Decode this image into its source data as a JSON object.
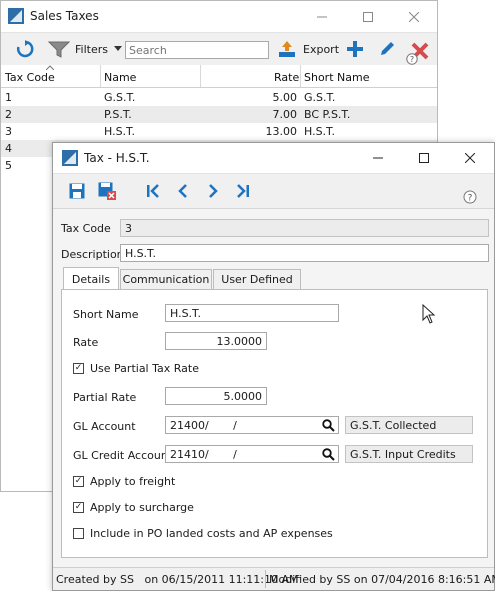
{
  "back_window": {
    "title": "Sales Taxes",
    "toolbar": {
      "filters_label": "Filters",
      "search_placeholder": "Search",
      "export_label": "Export"
    },
    "columns": [
      "Tax Code",
      "Name",
      "Rate",
      "Short Name"
    ],
    "rows": [
      {
        "code": "1",
        "name": "G.S.T.",
        "rate": "5.00",
        "short": "G.S.T."
      },
      {
        "code": "2",
        "name": "P.S.T.",
        "rate": "7.00",
        "short": "BC P.S.T."
      },
      {
        "code": "3",
        "name": "H.S.T.",
        "rate": "13.00",
        "short": "H.S.T."
      },
      {
        "code": "4",
        "name": "",
        "rate": "",
        "short": ""
      },
      {
        "code": "5",
        "name": "",
        "rate": "",
        "short": ""
      }
    ]
  },
  "front_window": {
    "title": "Tax - H.S.T.",
    "tax_code_label": "Tax Code",
    "tax_code_value": "3",
    "description_label": "Description",
    "description_value": "H.S.T.",
    "tabs": [
      "Details",
      "Communication",
      "User Defined"
    ],
    "details": {
      "short_name_label": "Short Name",
      "short_name_value": "H.S.T.",
      "rate_label": "Rate",
      "rate_value": "13.0000",
      "use_partial_label": "Use Partial Tax Rate",
      "use_partial_checked": true,
      "partial_rate_label": "Partial Rate",
      "partial_rate_value": "5.0000",
      "gl_account_label": "GL Account",
      "gl_account_value": "21400/       /",
      "gl_account_desc": "G.S.T. Collected",
      "gl_credit_label": "GL Credit Account",
      "gl_credit_value": "21410/       /",
      "gl_credit_desc": "G.S.T. Input Credits",
      "freight_label": "Apply to freight",
      "freight_checked": true,
      "surcharge_label": "Apply to surcharge",
      "surcharge_checked": true,
      "landed_label": "Include in PO landed costs and AP expenses",
      "landed_checked": false
    },
    "status": {
      "created": "Created by SS   on 06/15/2011 11:11:10 AM",
      "modified": "Modified by SS on 07/04/2016 8:16:51 AM"
    }
  },
  "colors": {
    "accent_blue": "#1e73be",
    "delete_red": "#d64b4b",
    "row_alt": "#ebebeb"
  }
}
